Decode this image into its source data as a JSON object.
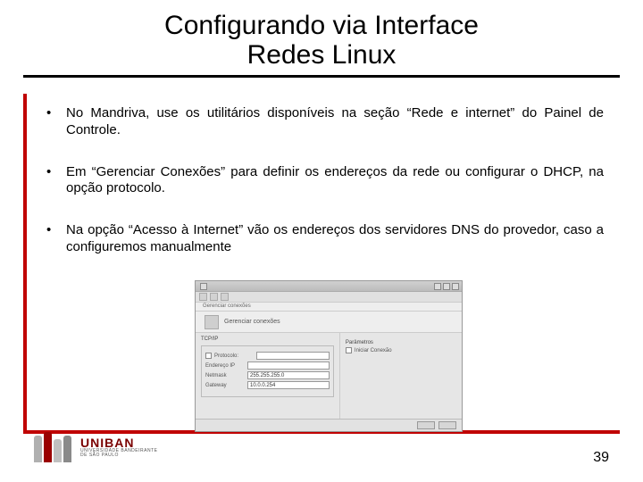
{
  "title_line1": "Configurando via Interface",
  "title_line2": "Redes Linux",
  "bullets": [
    "No Mandriva, use os utilitários disponíveis na seção “Rede e internet” do Painel de Controle.",
    "Em “Gerenciar Conexões” para definir os endereços da rede ou configurar o DHCP, na opção protocolo.",
    "Na opção “Acesso à Internet” vão os endereços dos servidores DNS do provedor, caso a configuremos manualmente"
  ],
  "screenshot": {
    "crumb": "Gerenciar conexões",
    "group_left": "TCP/IP",
    "protocol_label": "Protocolo:",
    "protocol_value": "",
    "ip_label": "Endereço IP",
    "ip_value": "",
    "mask_label": "Netmask",
    "mask_value": "255.255.255.0",
    "gw_label": "Gateway",
    "gw_value": "10.0.0.254",
    "col_right_label": "Parâmetros",
    "col_right_sub": "Iniciar Conexão"
  },
  "logo": {
    "name": "UNIBAN",
    "sub1": "UNIVERSIDADE BANDEIRANTE",
    "sub2": "DE SÃO PAULO"
  },
  "page_number": "39"
}
